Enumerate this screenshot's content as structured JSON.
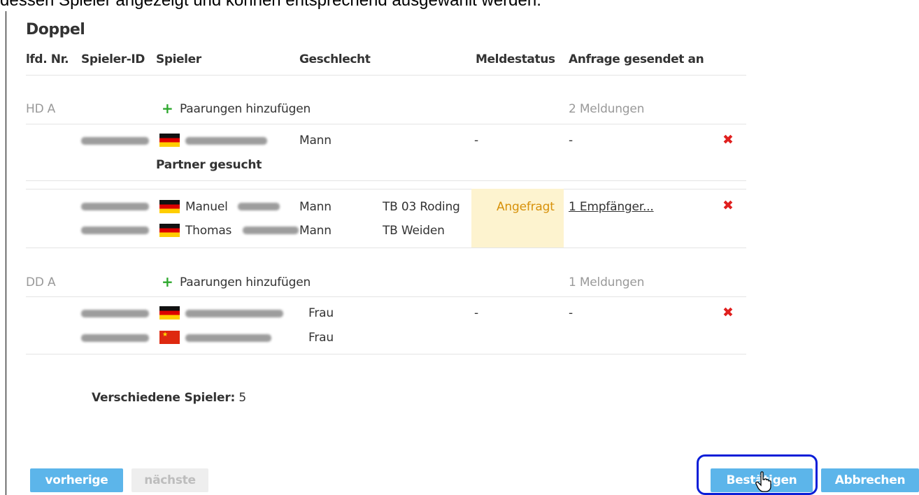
{
  "intro_text": "dessen Spieler angezeigt und können entsprechend ausgewählt werden.",
  "section_title": "Doppel",
  "columns": {
    "lfd_nr": "lfd. Nr.",
    "spieler_id": "Spieler-ID",
    "spieler": "Spieler",
    "geschlecht": "Geschlecht",
    "meldestatus": "Meldestatus",
    "anfrage": "Anfrage gesendet an"
  },
  "groups": [
    {
      "name": "HD A",
      "add_label": "Paarungen hinzufügen",
      "count": "2 Meldungen",
      "entries": [
        {
          "players": [
            {
              "first_name": "",
              "gender": "Mann",
              "club": "",
              "flag": "de"
            }
          ],
          "partner_note": "Partner gesucht",
          "status": "-",
          "sent_to": "-"
        },
        {
          "players": [
            {
              "first_name": "Manuel",
              "gender": "Mann",
              "club": "TB 03 Roding",
              "flag": "de"
            },
            {
              "first_name": "Thomas",
              "gender": "Mann",
              "club": "TB Weiden",
              "flag": "de"
            }
          ],
          "status": "Angefragt",
          "sent_to": "1 Empfänger..."
        }
      ]
    },
    {
      "name": "DD A",
      "add_label": "Paarungen hinzufügen",
      "count": "1 Meldungen",
      "entries": [
        {
          "players": [
            {
              "first_name": "",
              "gender": "Frau",
              "club": "",
              "flag": "de"
            },
            {
              "first_name": "",
              "gender": "Frau",
              "club": "",
              "flag": "cn"
            }
          ],
          "status": "-",
          "sent_to": "-"
        }
      ]
    }
  ],
  "summary": {
    "label": "Verschiedene Spieler:",
    "value": "5"
  },
  "buttons": {
    "prev": "vorherige",
    "next": "nächste",
    "confirm": "Bestätigen",
    "cancel": "Abbrechen"
  },
  "icons": {
    "add": "plus-icon",
    "remove": "remove-x-icon",
    "remove_glyph": "✖",
    "add_glyph": "+"
  },
  "colors": {
    "button_blue": "#5cb5ea",
    "status_bg": "#fdf3cf",
    "status_text": "#d7910a",
    "remove_red": "#e0201f",
    "add_green": "#2ea82e",
    "focus_ring": "#0a1ed8"
  }
}
